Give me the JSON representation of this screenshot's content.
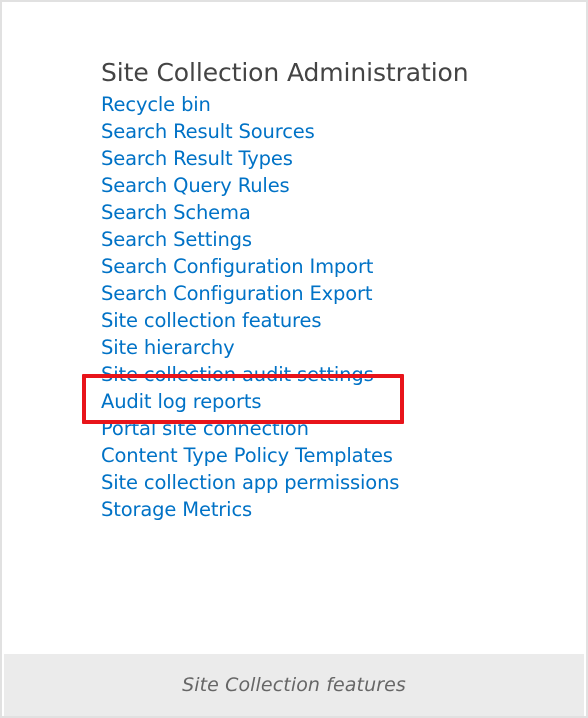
{
  "section": {
    "heading": "Site Collection Administration",
    "links": [
      "Recycle bin",
      "Search Result Sources",
      "Search Result Types",
      "Search Query Rules",
      "Search Schema",
      "Search Settings",
      "Search Configuration Import",
      "Search Configuration Export",
      "Site collection features",
      "Site hierarchy",
      "Site collection audit settings",
      "Audit log reports",
      "Portal site connection",
      "Content Type Policy Templates",
      "Site collection app permissions",
      "Storage Metrics"
    ],
    "highlighted_index": 8
  },
  "caption": "Site Collection features",
  "colors": {
    "link": "#0072c6",
    "heading": "#444444",
    "highlight": "#e8141a",
    "caption_bg": "#ebebeb"
  }
}
